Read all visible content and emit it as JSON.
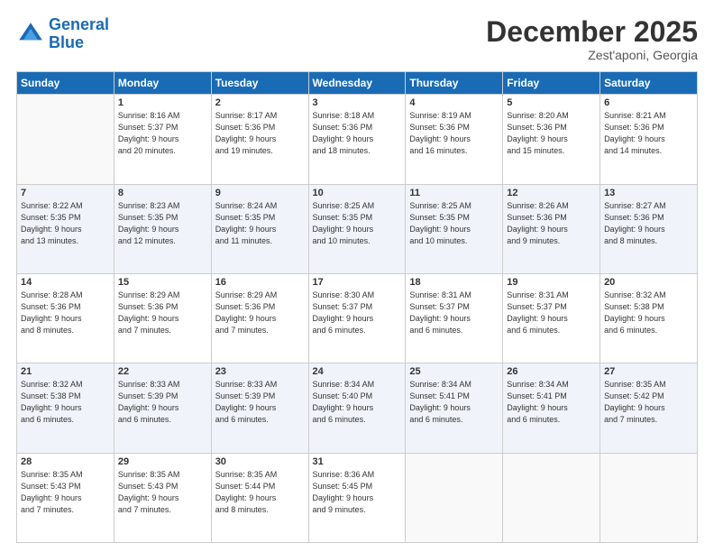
{
  "header": {
    "logo_line1": "General",
    "logo_line2": "Blue",
    "month": "December 2025",
    "location": "Zest'aponi, Georgia"
  },
  "weekdays": [
    "Sunday",
    "Monday",
    "Tuesday",
    "Wednesday",
    "Thursday",
    "Friday",
    "Saturday"
  ],
  "weeks": [
    [
      {
        "day": "",
        "info": ""
      },
      {
        "day": "1",
        "info": "Sunrise: 8:16 AM\nSunset: 5:37 PM\nDaylight: 9 hours\nand 20 minutes."
      },
      {
        "day": "2",
        "info": "Sunrise: 8:17 AM\nSunset: 5:36 PM\nDaylight: 9 hours\nand 19 minutes."
      },
      {
        "day": "3",
        "info": "Sunrise: 8:18 AM\nSunset: 5:36 PM\nDaylight: 9 hours\nand 18 minutes."
      },
      {
        "day": "4",
        "info": "Sunrise: 8:19 AM\nSunset: 5:36 PM\nDaylight: 9 hours\nand 16 minutes."
      },
      {
        "day": "5",
        "info": "Sunrise: 8:20 AM\nSunset: 5:36 PM\nDaylight: 9 hours\nand 15 minutes."
      },
      {
        "day": "6",
        "info": "Sunrise: 8:21 AM\nSunset: 5:36 PM\nDaylight: 9 hours\nand 14 minutes."
      }
    ],
    [
      {
        "day": "7",
        "info": "Sunrise: 8:22 AM\nSunset: 5:35 PM\nDaylight: 9 hours\nand 13 minutes."
      },
      {
        "day": "8",
        "info": "Sunrise: 8:23 AM\nSunset: 5:35 PM\nDaylight: 9 hours\nand 12 minutes."
      },
      {
        "day": "9",
        "info": "Sunrise: 8:24 AM\nSunset: 5:35 PM\nDaylight: 9 hours\nand 11 minutes."
      },
      {
        "day": "10",
        "info": "Sunrise: 8:25 AM\nSunset: 5:35 PM\nDaylight: 9 hours\nand 10 minutes."
      },
      {
        "day": "11",
        "info": "Sunrise: 8:25 AM\nSunset: 5:35 PM\nDaylight: 9 hours\nand 10 minutes."
      },
      {
        "day": "12",
        "info": "Sunrise: 8:26 AM\nSunset: 5:36 PM\nDaylight: 9 hours\nand 9 minutes."
      },
      {
        "day": "13",
        "info": "Sunrise: 8:27 AM\nSunset: 5:36 PM\nDaylight: 9 hours\nand 8 minutes."
      }
    ],
    [
      {
        "day": "14",
        "info": "Sunrise: 8:28 AM\nSunset: 5:36 PM\nDaylight: 9 hours\nand 8 minutes."
      },
      {
        "day": "15",
        "info": "Sunrise: 8:29 AM\nSunset: 5:36 PM\nDaylight: 9 hours\nand 7 minutes."
      },
      {
        "day": "16",
        "info": "Sunrise: 8:29 AM\nSunset: 5:36 PM\nDaylight: 9 hours\nand 7 minutes."
      },
      {
        "day": "17",
        "info": "Sunrise: 8:30 AM\nSunset: 5:37 PM\nDaylight: 9 hours\nand 6 minutes."
      },
      {
        "day": "18",
        "info": "Sunrise: 8:31 AM\nSunset: 5:37 PM\nDaylight: 9 hours\nand 6 minutes."
      },
      {
        "day": "19",
        "info": "Sunrise: 8:31 AM\nSunset: 5:37 PM\nDaylight: 9 hours\nand 6 minutes."
      },
      {
        "day": "20",
        "info": "Sunrise: 8:32 AM\nSunset: 5:38 PM\nDaylight: 9 hours\nand 6 minutes."
      }
    ],
    [
      {
        "day": "21",
        "info": "Sunrise: 8:32 AM\nSunset: 5:38 PM\nDaylight: 9 hours\nand 6 minutes."
      },
      {
        "day": "22",
        "info": "Sunrise: 8:33 AM\nSunset: 5:39 PM\nDaylight: 9 hours\nand 6 minutes."
      },
      {
        "day": "23",
        "info": "Sunrise: 8:33 AM\nSunset: 5:39 PM\nDaylight: 9 hours\nand 6 minutes."
      },
      {
        "day": "24",
        "info": "Sunrise: 8:34 AM\nSunset: 5:40 PM\nDaylight: 9 hours\nand 6 minutes."
      },
      {
        "day": "25",
        "info": "Sunrise: 8:34 AM\nSunset: 5:41 PM\nDaylight: 9 hours\nand 6 minutes."
      },
      {
        "day": "26",
        "info": "Sunrise: 8:34 AM\nSunset: 5:41 PM\nDaylight: 9 hours\nand 6 minutes."
      },
      {
        "day": "27",
        "info": "Sunrise: 8:35 AM\nSunset: 5:42 PM\nDaylight: 9 hours\nand 7 minutes."
      }
    ],
    [
      {
        "day": "28",
        "info": "Sunrise: 8:35 AM\nSunset: 5:43 PM\nDaylight: 9 hours\nand 7 minutes."
      },
      {
        "day": "29",
        "info": "Sunrise: 8:35 AM\nSunset: 5:43 PM\nDaylight: 9 hours\nand 7 minutes."
      },
      {
        "day": "30",
        "info": "Sunrise: 8:35 AM\nSunset: 5:44 PM\nDaylight: 9 hours\nand 8 minutes."
      },
      {
        "day": "31",
        "info": "Sunrise: 8:36 AM\nSunset: 5:45 PM\nDaylight: 9 hours\nand 9 minutes."
      },
      {
        "day": "",
        "info": ""
      },
      {
        "day": "",
        "info": ""
      },
      {
        "day": "",
        "info": ""
      }
    ]
  ]
}
